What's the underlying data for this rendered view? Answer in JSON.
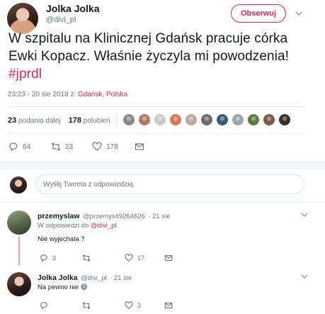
{
  "tweet": {
    "author_name": "Jolka Jolka",
    "author_handle": "@divi_pl",
    "follow_label": "Obserwuj",
    "text_main": "W szpitalu na Klinicznej Gdańsk pracuje córka Ewki Kopacz. Właśnie życzyla mi powodzenia!",
    "hashtag": "#jprdl",
    "timestamp": "23:23 - 20 sie 2018 z: ",
    "location": "Gdańsk, Polska",
    "retweets_count": "23",
    "retweets_label": "podania dalej",
    "likes_count": "178",
    "likes_label": "polubień",
    "likers_colors": [
      "#8a8a8a",
      "#b07a6a",
      "#c9c9c9",
      "#d97a55",
      "#c0a79e",
      "#6d6d6d",
      "#3c5a78",
      "#9aa5ad",
      "#5c7a3a",
      "#7a5c4a",
      "#3a2e2a"
    ],
    "actions": {
      "reply_count": "64",
      "retweet_count": "23",
      "like_count": "178"
    }
  },
  "reply_box": {
    "placeholder": "Wyślij Tweeta z odpowiedzią"
  },
  "replies": [
    {
      "name": "przemyslaw",
      "handle": "@przemys49264626",
      "time": "· 21 sie",
      "replying_prefix": "W odpowiedzi do",
      "replying_to": "@divi_pl",
      "text": "Nie wyjechala ?",
      "reply_count": "3",
      "retweet_count": "",
      "like_count": "17"
    },
    {
      "name": "Jolka Jolka",
      "handle": "@divi_pl",
      "time": "· 21 sie",
      "text": "Na pewno nie",
      "emoji": "😄",
      "reply_count": "",
      "retweet_count": "",
      "like_count": "3"
    }
  ],
  "colors": {
    "accent": "#e0245e",
    "muted": "#657786",
    "text": "#14171a",
    "border": "#e6ecf0"
  }
}
